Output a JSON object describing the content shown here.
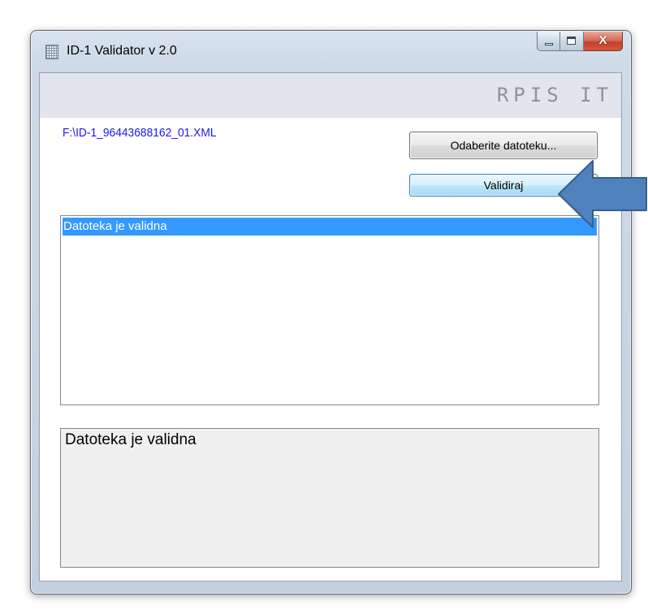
{
  "window": {
    "title": "ID-1 Validator v 2.0",
    "icon": "application-grid-icon",
    "caption_buttons": {
      "minimize": "minimize-icon",
      "maximize": "maximize-icon",
      "close": "X"
    }
  },
  "header": {
    "logo_text": "RPIS IT"
  },
  "file": {
    "path": "F:\\ID-1_96443688162_01.XML"
  },
  "buttons": {
    "browse_label": "Odaberite datoteku...",
    "validate_label": "Validiraj"
  },
  "results_list": {
    "items": [
      "Datoteka je validna"
    ],
    "selected_index": 0
  },
  "details": {
    "text": "Datoteka je validna"
  },
  "annotation": {
    "icon": "left-arrow-icon",
    "color": "#4f81bd"
  },
  "colors": {
    "selection": "#3399ff",
    "path_text": "#1a1aef",
    "header_band": "#e2e4ee"
  }
}
